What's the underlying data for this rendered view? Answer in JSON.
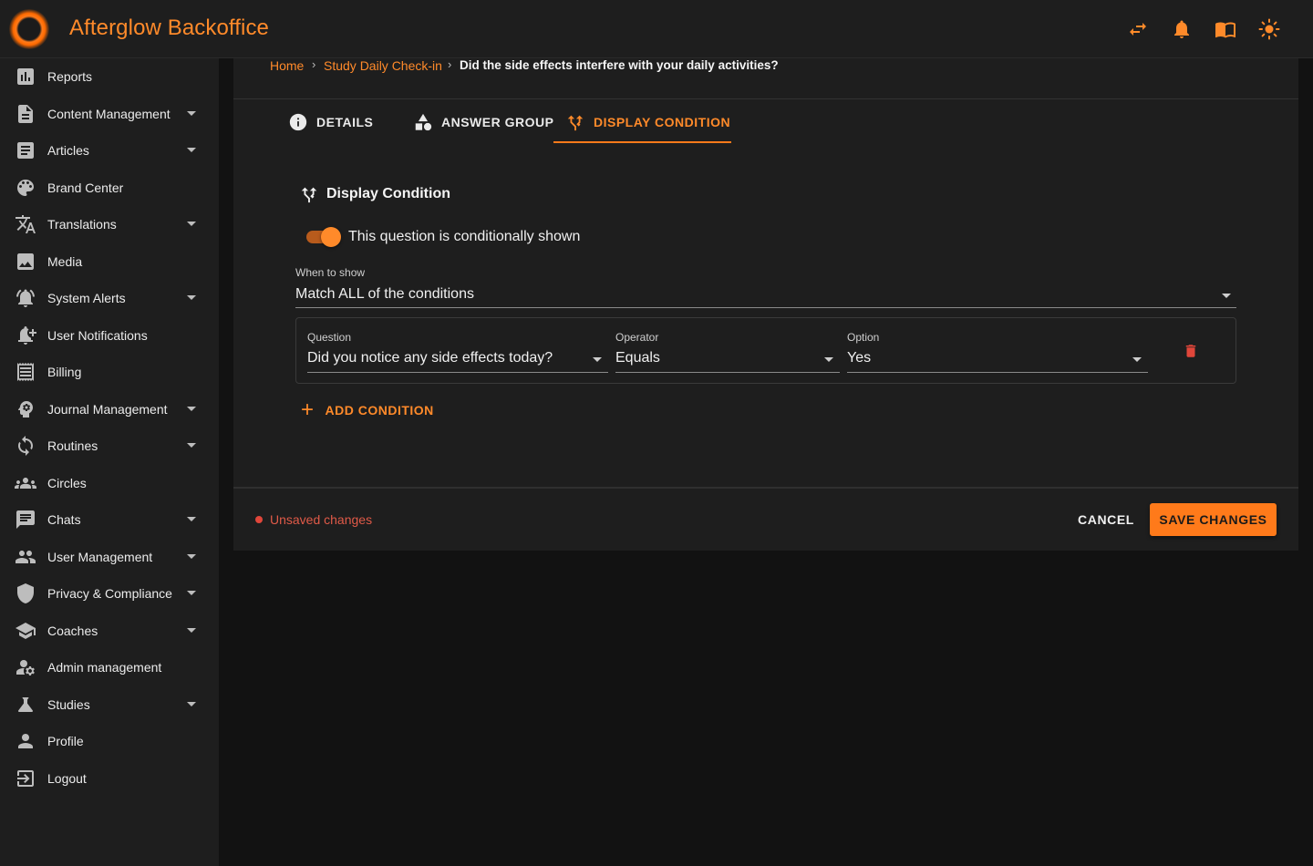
{
  "header": {
    "app_title": "Afterglow Backoffice",
    "icons": [
      "swap-icon",
      "notifications-bell-icon",
      "docs-book-icon",
      "light-mode-sun-icon"
    ]
  },
  "sidebar": {
    "items": [
      {
        "label": "Reports",
        "icon": "bar-chart-icon",
        "expandable": false
      },
      {
        "label": "Content Management",
        "icon": "document-icon",
        "expandable": true
      },
      {
        "label": "Articles",
        "icon": "article-icon",
        "expandable": true
      },
      {
        "label": "Brand Center",
        "icon": "palette-icon",
        "expandable": false
      },
      {
        "label": "Translations",
        "icon": "translate-icon",
        "expandable": true
      },
      {
        "label": "Media",
        "icon": "image-icon",
        "expandable": false
      },
      {
        "label": "System Alerts",
        "icon": "alarm-bell-icon",
        "expandable": true
      },
      {
        "label": "User Notifications",
        "icon": "bell-plus-icon",
        "expandable": false
      },
      {
        "label": "Billing",
        "icon": "receipt-icon",
        "expandable": false
      },
      {
        "label": "Journal Management",
        "icon": "psychology-icon",
        "expandable": true
      },
      {
        "label": "Routines",
        "icon": "sync-icon",
        "expandable": true
      },
      {
        "label": "Circles",
        "icon": "group-icon",
        "expandable": false
      },
      {
        "label": "Chats",
        "icon": "chat-icon",
        "expandable": true
      },
      {
        "label": "User Management",
        "icon": "people-icon",
        "expandable": true
      },
      {
        "label": "Privacy & Compliance",
        "icon": "shield-icon",
        "expandable": true
      },
      {
        "label": "Coaches",
        "icon": "school-icon",
        "expandable": true
      },
      {
        "label": "Admin management",
        "icon": "manage-accounts-icon",
        "expandable": false
      },
      {
        "label": "Studies",
        "icon": "flask-icon",
        "expandable": true
      },
      {
        "label": "Profile",
        "icon": "person-icon",
        "expandable": false
      },
      {
        "label": "Logout",
        "icon": "logout-icon",
        "expandable": false
      }
    ]
  },
  "breadcrumb": {
    "home": "Home",
    "parent": "Study Daily Check-in",
    "current": "Did the side effects interfere with your daily activities?",
    "separator": "›"
  },
  "tabs": {
    "details": "DETAILS",
    "answer_group": "ANSWER GROUP",
    "display_condition": "DISPLAY CONDITION",
    "active": "display_condition"
  },
  "display_condition": {
    "title": "Display Condition",
    "toggle_label": "This question is conditionally shown",
    "toggle_on": true,
    "when_label": "When to show",
    "when_value": "Match ALL of the conditions",
    "conditions": [
      {
        "question_label": "Question",
        "question_value": "Did you notice any side effects today?",
        "operator_label": "Operator",
        "operator_value": "Equals",
        "option_label": "Option",
        "option_value": "Yes"
      }
    ],
    "add_condition": "ADD CONDITION"
  },
  "footer": {
    "unsaved": "Unsaved changes",
    "cancel": "CANCEL",
    "save": "SAVE CHANGES"
  },
  "colors": {
    "accent": "#ff7a1a",
    "danger": "#e0463a",
    "surface": "#1e1e1e",
    "background": "#121212"
  }
}
